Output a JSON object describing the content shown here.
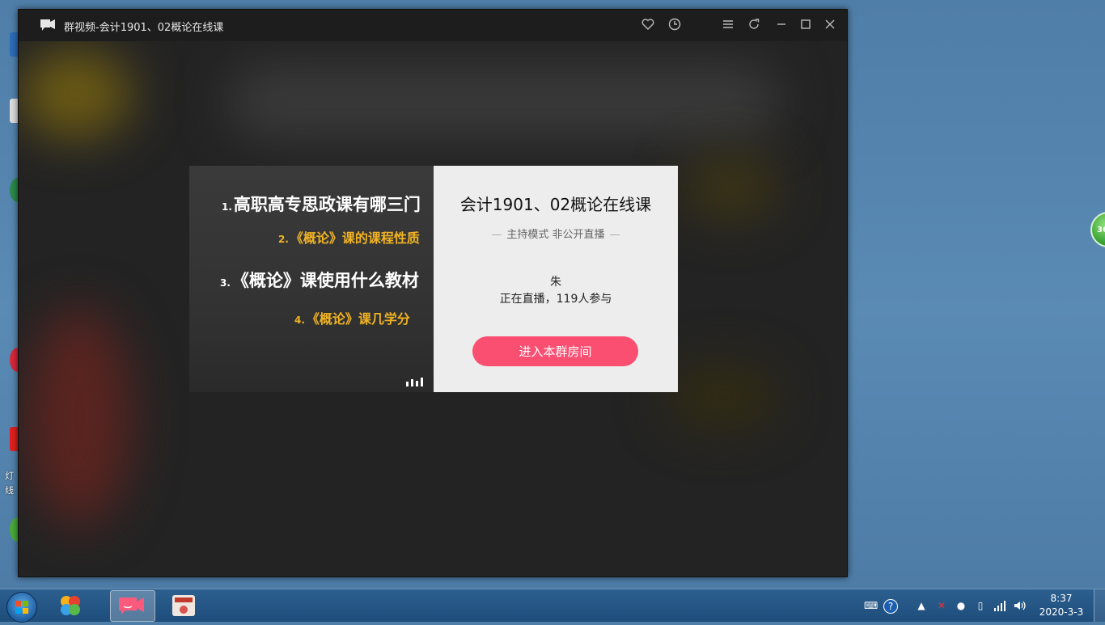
{
  "window": {
    "title": "群视频-会计1901、02概论在线课",
    "controls": [
      "heart-icon",
      "history-icon",
      "menu-icon",
      "refresh-icon",
      "minimize-icon",
      "maximize-icon",
      "close-icon"
    ]
  },
  "slide": {
    "line1_num": "1.",
    "line1": "高职高专思政课有哪三门",
    "line2_num": "2.",
    "line2": "《概论》课的课程性质",
    "line3_num": "3.",
    "line3": "《概论》课使用什么教材",
    "line4_num": "4.",
    "line4": "《概论》课几学分"
  },
  "room": {
    "name": "会计1901、02概论在线课",
    "mode": "主持模式 非公开直播",
    "host": "朱",
    "status": "正在直播，119人参与",
    "enter_button": "进入本群房间"
  },
  "desktop": {
    "labels": [
      "灯",
      "线"
    ],
    "side_widget": "36"
  },
  "taskbar": {
    "time": "8:37",
    "date": "2020-3-3"
  },
  "colors": {
    "accent": "#fb4f72",
    "slide_highlight": "#f1b322",
    "window_bg": "#232323"
  }
}
